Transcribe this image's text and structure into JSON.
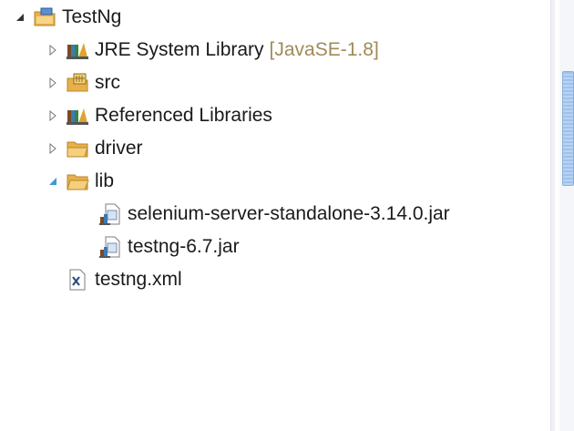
{
  "tree": {
    "project": {
      "label": "TestNg"
    },
    "items": [
      {
        "label": "JRE System Library",
        "decoration": "[JavaSE-1.8]",
        "icon": "library-icon"
      },
      {
        "label": "src",
        "icon": "package-folder-icon"
      },
      {
        "label": "Referenced Libraries",
        "icon": "library-icon"
      },
      {
        "label": "driver",
        "icon": "folder-icon"
      },
      {
        "label": "lib",
        "icon": "folder-open-icon"
      }
    ],
    "lib_children": [
      {
        "label": "selenium-server-standalone-3.14.0.jar",
        "icon": "jar-icon"
      },
      {
        "label": "testng-6.7.jar",
        "icon": "jar-icon"
      }
    ],
    "root_file": {
      "label": "testng.xml",
      "icon": "xml-file-icon"
    }
  },
  "colors": {
    "twisty_expanded": "#3c9ad9",
    "decoration": "#a08a58",
    "folder": "#e8b04a",
    "scroll_thumb": "#9fc2ea"
  }
}
